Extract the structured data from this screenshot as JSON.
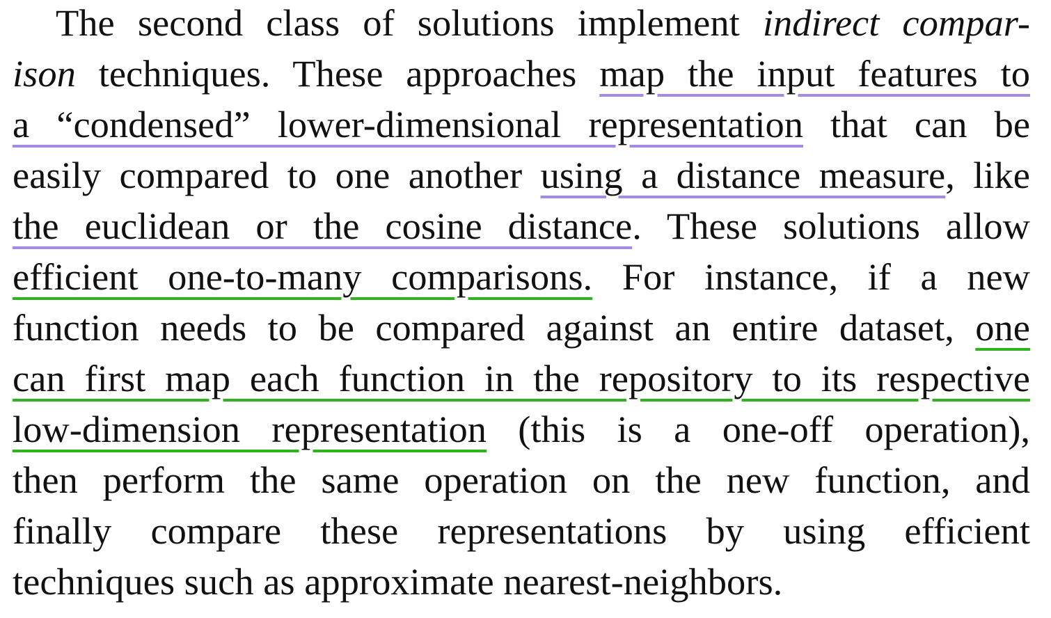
{
  "paragraph": {
    "l1_a": "The second class of solutions implement ",
    "l1_b": "indirect compar-",
    "l2_a": "ison",
    "l2_b": " techniques. These approaches ",
    "l2_c": "map the input features to",
    "l3_a": "a “condensed” lower-dimensional representation",
    "l3_b": " that can be",
    "l4_a": "easily compared to one another ",
    "l4_b": "using a distance measure",
    "l4_c": ", like",
    "l5_a": "the euclidean or the cosine distance",
    "l5_b": ". These solutions allow",
    "l6_a": "efficient one-to-many comparisons.",
    "l6_b": " For instance, if a new",
    "l7_a": "function needs to be compared against an entire dataset, ",
    "l7_b": "one",
    "l8_a": "can first map each function in the repository to its respective",
    "l9_a": "low-dimension representation",
    "l9_b": " (this is a one-off operation),",
    "l10_a": "then perform the same operation on the new function, and",
    "l11_a": "finally compare these representations by using efficient",
    "l12_a": "techniques such as approximate nearest-neighbors."
  },
  "highlight_colors": {
    "purple": "#a58be3",
    "green": "#2fb31f"
  }
}
